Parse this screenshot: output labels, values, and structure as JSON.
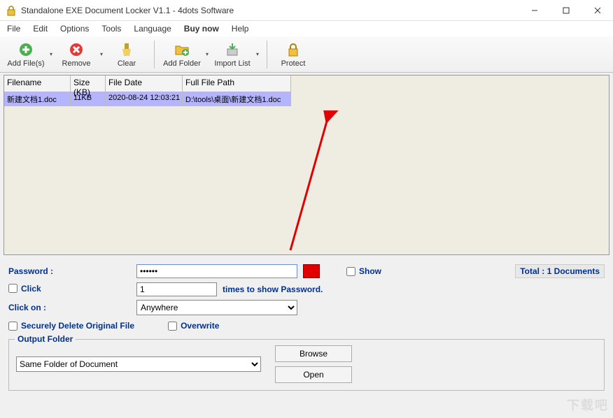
{
  "title": "Standalone EXE Document Locker V1.1 - 4dots Software",
  "menu": {
    "file": "File",
    "edit": "Edit",
    "options": "Options",
    "tools": "Tools",
    "language": "Language",
    "buynow": "Buy now",
    "help": "Help"
  },
  "toolbar": {
    "add": "Add File(s)",
    "remove": "Remove",
    "clear": "Clear",
    "addfolder": "Add Folder",
    "import": "Import List",
    "protect": "Protect"
  },
  "grid": {
    "headers": {
      "filename": "Filename",
      "size": "Size (KB)",
      "date": "File Date",
      "path": "Full File Path"
    },
    "rows": [
      {
        "filename": "新建文档1.doc",
        "size": "11KB",
        "date": "2020-08-24 12:03:21",
        "path": "D:\\tools\\桌面\\新建文档1.doc"
      }
    ]
  },
  "form": {
    "password_label": "Password :",
    "password_value": "••••••",
    "show": "Show",
    "total": "Total : 1 Documents",
    "click": "Click",
    "click_count": "1",
    "click_suffix": "times to show Password.",
    "clickon_label": "Click on :",
    "clickon_value": "Anywhere",
    "secdel": "Securely Delete Original File",
    "overwrite": "Overwrite"
  },
  "output": {
    "legend": "Output Folder",
    "value": "Same Folder of Document",
    "browse": "Browse",
    "open": "Open"
  },
  "watermark": "下载吧"
}
